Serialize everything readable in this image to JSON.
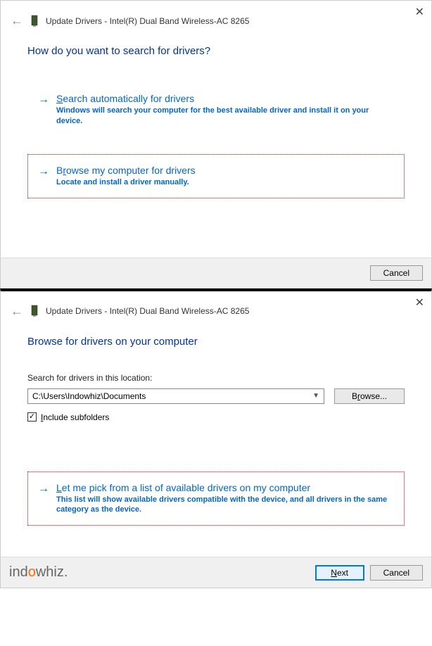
{
  "dialog1": {
    "title": "Update Drivers - Intel(R) Dual Band Wireless-AC 8265",
    "heading": "How do you want to search for drivers?",
    "opt1": {
      "title_pre": "",
      "title_u": "S",
      "title_post": "earch automatically for drivers",
      "desc": "Windows will search your computer for the best available driver and install it on your device."
    },
    "opt2": {
      "title_pre": "B",
      "title_u": "r",
      "title_post": "owse my computer for drivers",
      "desc": "Locate and install a driver manually."
    },
    "cancel": "Cancel"
  },
  "dialog2": {
    "title": "Update Drivers - Intel(R) Dual Band Wireless-AC 8265",
    "heading": "Browse for drivers on your computer",
    "field_label": "Search for drivers in this location:",
    "path": "C:\\Users\\Indowhiz\\Documents",
    "browse_pre": "B",
    "browse_u": "r",
    "browse_post": "owse...",
    "include_pre": "",
    "include_u": "I",
    "include_post": "nclude subfolders",
    "opt": {
      "title_pre": "",
      "title_u": "L",
      "title_post": "et me pick from a list of available drivers on my computer",
      "desc": "This list will show available drivers compatible with the device, and all drivers in the same category as the device."
    },
    "next_pre": "",
    "next_u": "N",
    "next_post": "ext",
    "cancel": "Cancel"
  },
  "logo": {
    "ind": "ind",
    "o": "o",
    "whiz": "whiz."
  }
}
